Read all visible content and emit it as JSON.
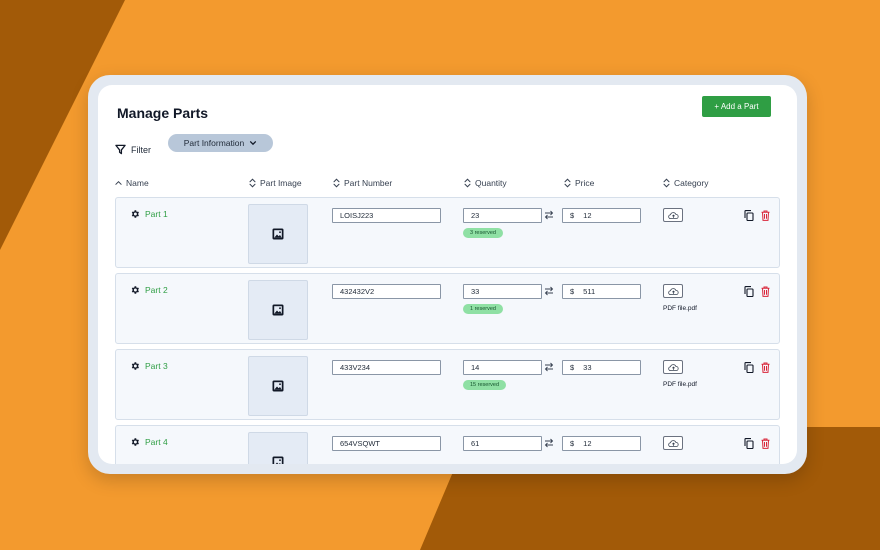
{
  "page": {
    "title": "Manage Parts",
    "add_button": "+ Add a Part",
    "filter_label": "Filter",
    "filter_chip": "Part Information"
  },
  "columns": [
    {
      "label": "Name",
      "icon": "chevron-up-icon"
    },
    {
      "label": "Part Image",
      "icon": "sort-icon"
    },
    {
      "label": "Part Number",
      "icon": "sort-icon"
    },
    {
      "label": "Quantity",
      "icon": "sort-icon"
    },
    {
      "label": "Price",
      "icon": "sort-icon"
    },
    {
      "label": "Category",
      "icon": "sort-icon"
    }
  ],
  "rows": [
    {
      "name": "Part 1",
      "part_number": "LOISJ223",
      "quantity": "23",
      "reserved": "3 reserved",
      "currency": "$",
      "price": "12",
      "file": ""
    },
    {
      "name": "Part 2",
      "part_number": "432432V2",
      "quantity": "33",
      "reserved": "1 reserved",
      "currency": "$",
      "price": "511",
      "file": "PDF file.pdf"
    },
    {
      "name": "Part 3",
      "part_number": "433V234",
      "quantity": "14",
      "reserved": "15 reserved",
      "currency": "$",
      "price": "33",
      "file": "PDF file.pdf"
    },
    {
      "name": "Part 4",
      "part_number": "654VSQWT",
      "quantity": "61",
      "reserved": "",
      "currency": "$",
      "price": "12",
      "file": ""
    }
  ],
  "colors": {
    "background": "#f39a2e",
    "background_dark": "#a25a08",
    "accent_green": "#2f9e44",
    "badge_green": "#8fe0a4",
    "delete_red": "#d9263a",
    "chip": "#b8c7d9"
  }
}
